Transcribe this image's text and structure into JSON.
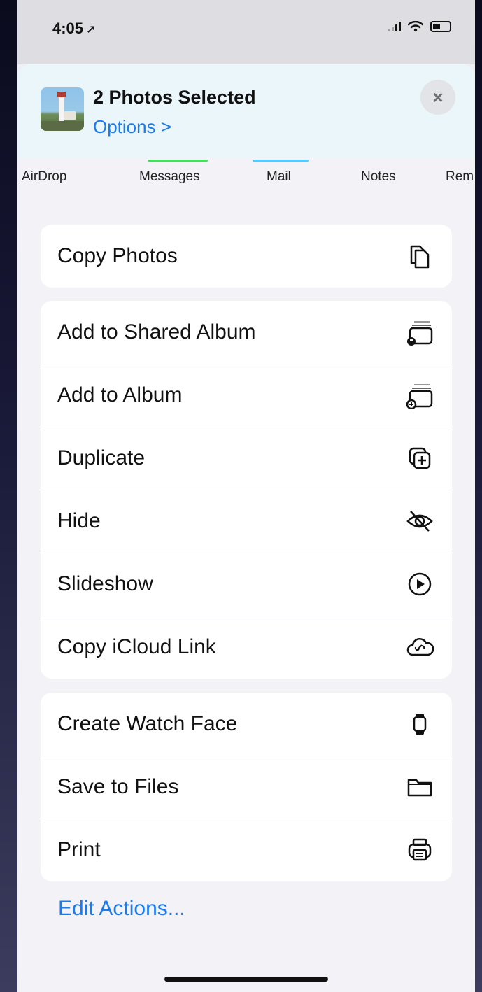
{
  "status_bar": {
    "time": "4:05",
    "location_arrow": "↗"
  },
  "header": {
    "title": "2 Photos Selected",
    "options_label": "Options >",
    "close_glyph": "×"
  },
  "share_apps": [
    {
      "label": "AirDrop",
      "accent": ""
    },
    {
      "label": "Messages",
      "accent": "#4cd964"
    },
    {
      "label": "Mail",
      "accent": "#5ac8fa"
    },
    {
      "label": "Notes",
      "accent": ""
    },
    {
      "label": "Rem",
      "accent": ""
    }
  ],
  "groups": [
    {
      "rows": [
        {
          "label": "Copy Photos",
          "icon": "copy-photos-icon"
        }
      ]
    },
    {
      "rows": [
        {
          "label": "Add to Shared Album",
          "icon": "shared-album-icon"
        },
        {
          "label": "Add to Album",
          "icon": "add-album-icon"
        },
        {
          "label": "Duplicate",
          "icon": "duplicate-icon"
        },
        {
          "label": "Hide",
          "icon": "hide-icon"
        },
        {
          "label": "Slideshow",
          "icon": "play-icon"
        },
        {
          "label": "Copy iCloud Link",
          "icon": "icloud-link-icon"
        }
      ]
    },
    {
      "rows": [
        {
          "label": "Create Watch Face",
          "icon": "watch-icon"
        },
        {
          "label": "Save to Files",
          "icon": "folder-icon"
        },
        {
          "label": "Print",
          "icon": "printer-icon"
        }
      ]
    }
  ],
  "edit_actions_label": "Edit Actions...",
  "colors": {
    "accent_blue": "#1a7bf0",
    "sheet_background": "#f2f2f7",
    "header_background": "#ebf6fb"
  }
}
